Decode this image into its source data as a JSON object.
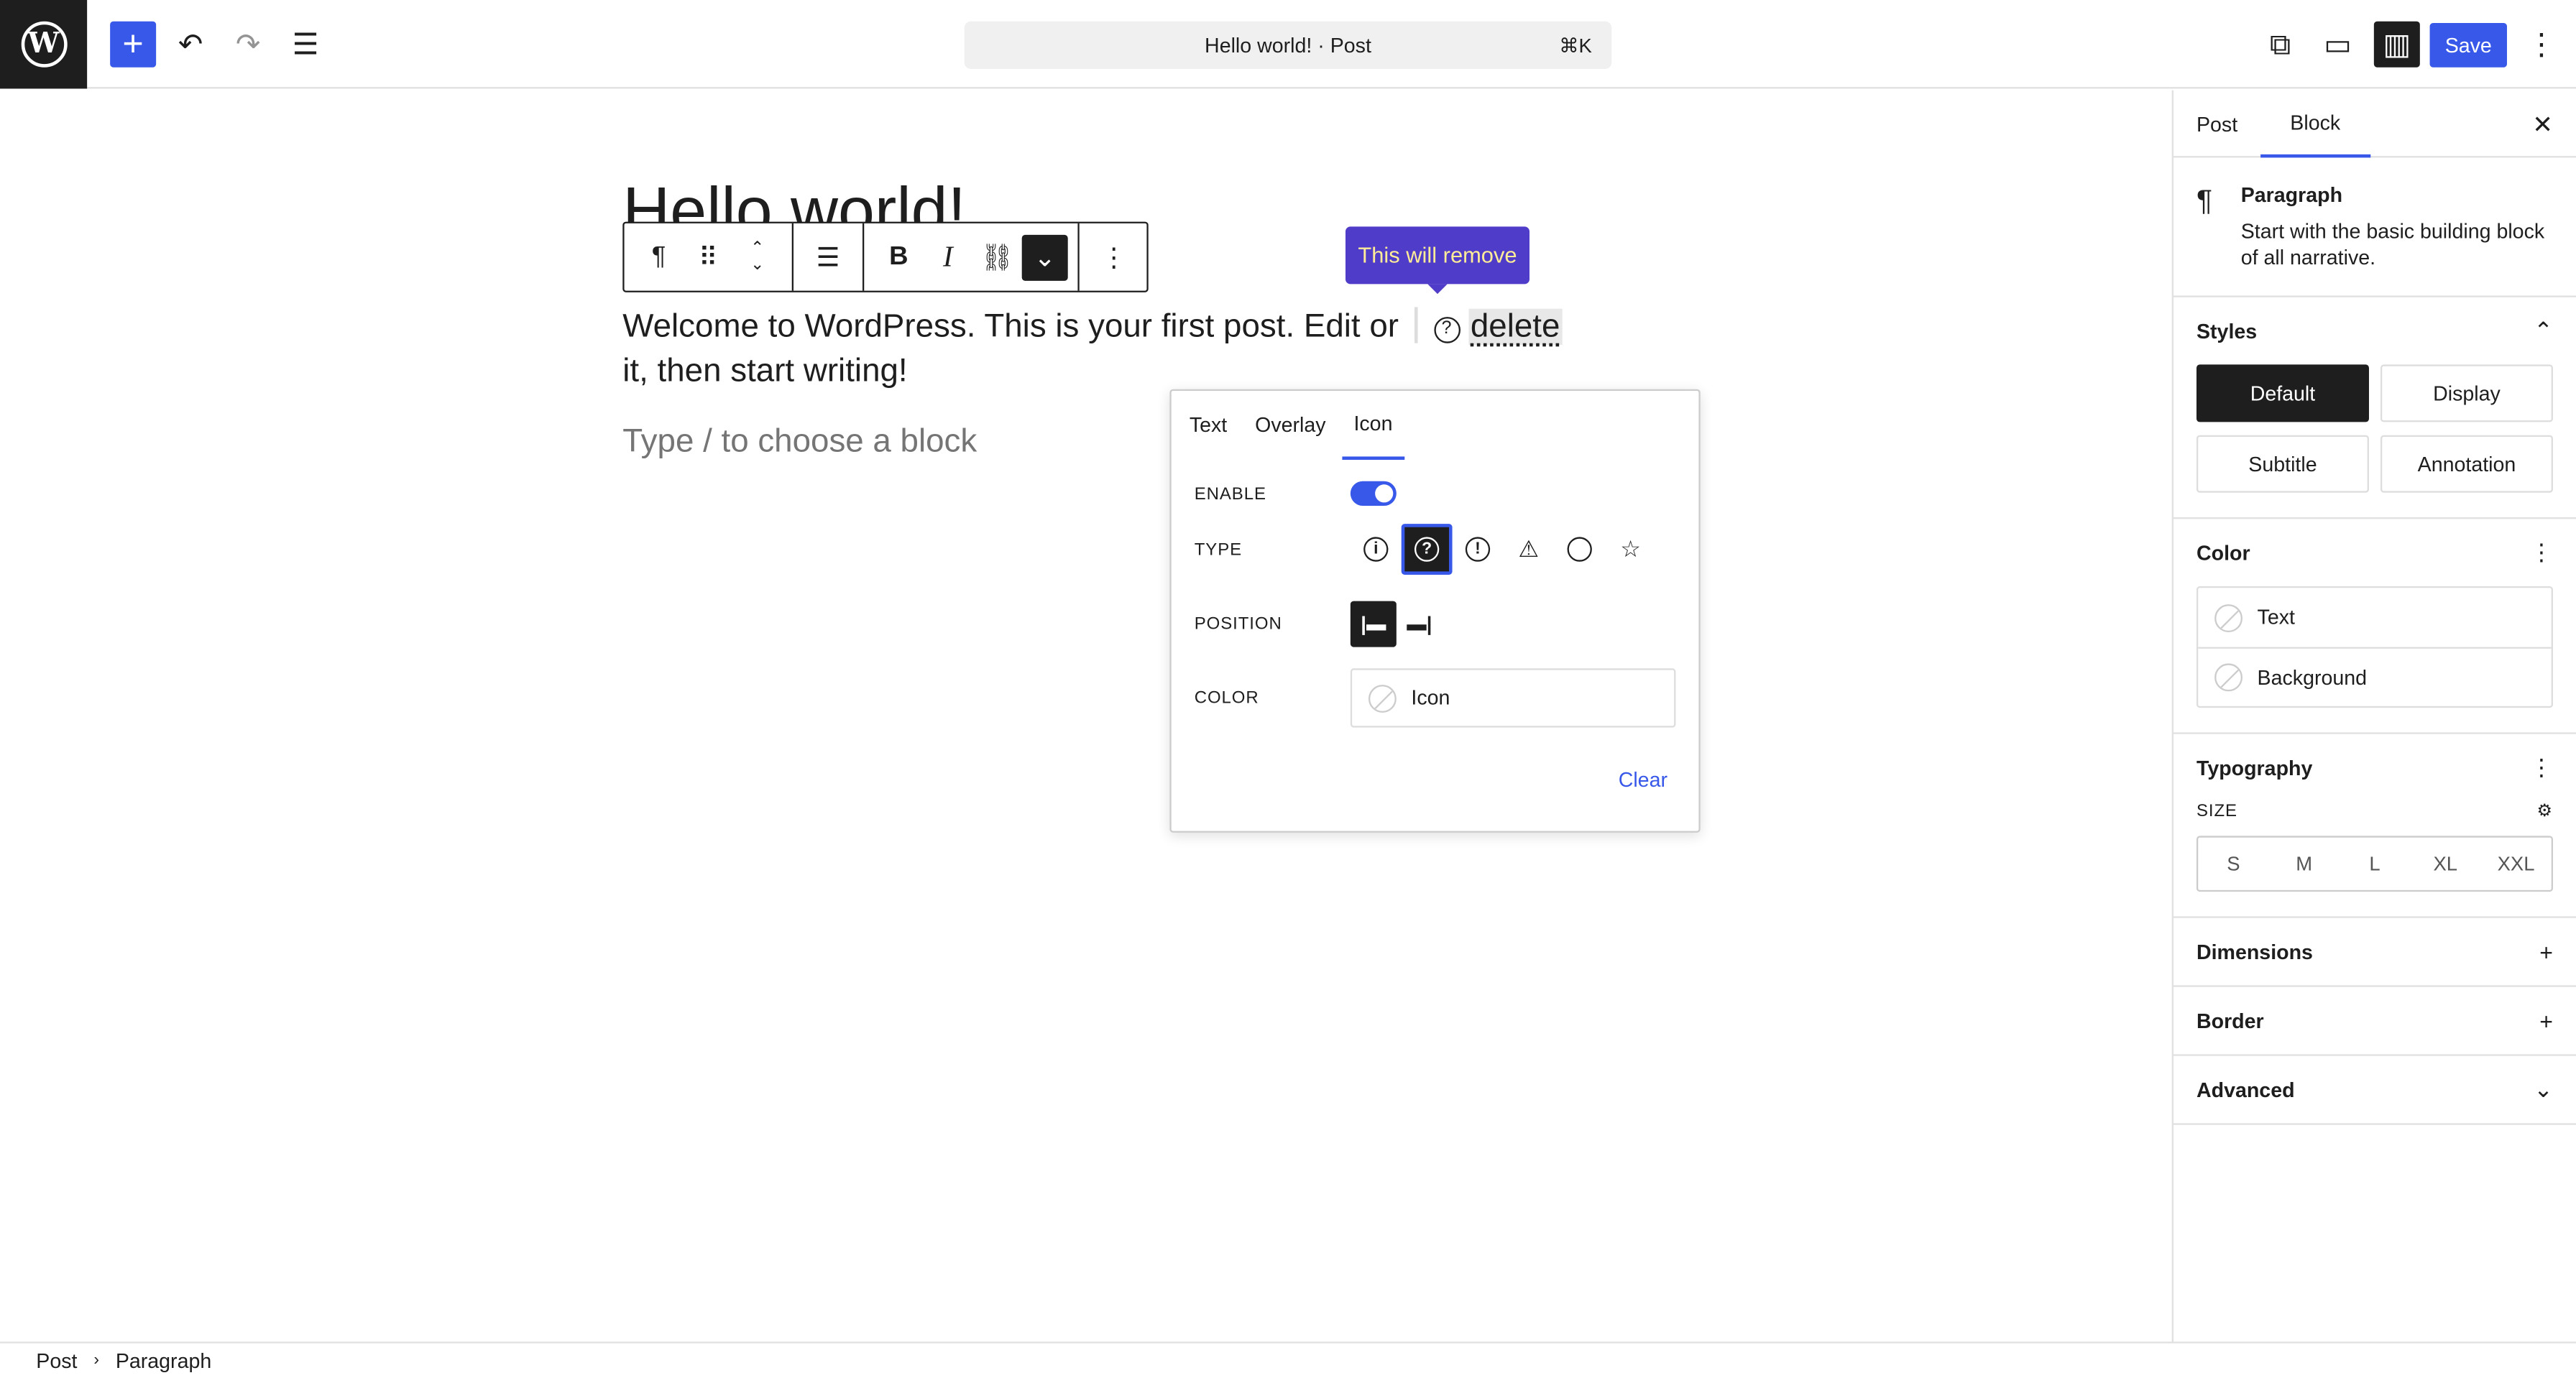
{
  "topbar": {
    "add_icon": "+",
    "undo_icon": "↶",
    "redo_icon": "↷",
    "listview_icon": "☰",
    "document_title": "Hello world! · Post",
    "shortcut": "⌘K",
    "view_icon": "⧉",
    "device_icon": "▭",
    "settings_icon": "▥",
    "save_label": "Save",
    "more_icon": "⋮"
  },
  "editor": {
    "title": "Hello world!",
    "paragraph_before": "Welcome to WordPress. This is your first post. Edit or",
    "paragraph_icon": "?",
    "paragraph_highlight": "delete",
    "paragraph_after": " it, then start writing!",
    "placeholder": "Type / to choose a block",
    "tooltip": "This will remove"
  },
  "toolbar": {
    "paragraph_icon": "¶",
    "drag_icon": "⠿",
    "up_icon": "⌃",
    "down_icon": "⌄",
    "align_icon": "☰",
    "bold": "B",
    "italic": "I",
    "link_icon": "⛓",
    "more_rich_icon": "⌄",
    "options_icon": "⋮"
  },
  "popover": {
    "tabs": [
      "Text",
      "Overlay",
      "Icon"
    ],
    "active_tab": "Icon",
    "enable_label": "ENABLE",
    "type_label": "TYPE",
    "type_icons": [
      "i",
      "?",
      "!",
      "⚠",
      "⃠",
      "☆"
    ],
    "position_label": "POSITION",
    "position_left_icon": "|▬",
    "position_right_icon": "▬|",
    "color_label": "COLOR",
    "color_value": "Icon",
    "clear_label": "Clear"
  },
  "sidebar": {
    "tabs": [
      "Post",
      "Block"
    ],
    "close_icon": "✕",
    "block_icon": "¶",
    "block_name": "Paragraph",
    "block_desc": "Start with the basic building block of all narrative.",
    "styles_title": "Styles",
    "styles_toggle": "⌃",
    "styles": [
      "Default",
      "Display",
      "Subtitle",
      "Annotation"
    ],
    "color_title": "Color",
    "color_menu": "⋮",
    "colors": [
      "Text",
      "Background"
    ],
    "typography_title": "Typography",
    "typography_menu": "⋮",
    "size_label": "SIZE",
    "size_settings_icon": "⚙",
    "sizes": [
      "S",
      "M",
      "L",
      "XL",
      "XXL"
    ],
    "dimensions_title": "Dimensions",
    "border_title": "Border",
    "advanced_title": "Advanced",
    "plus_icon": "+",
    "chevron_icon": "⌄"
  },
  "breadcrumb": {
    "items": [
      "Post",
      "Paragraph"
    ],
    "separator": "›"
  },
  "colors": {
    "accent": "#3858e9",
    "tooltip_bg": "#4f3cc9",
    "tooltip_text": "#ffec99"
  }
}
